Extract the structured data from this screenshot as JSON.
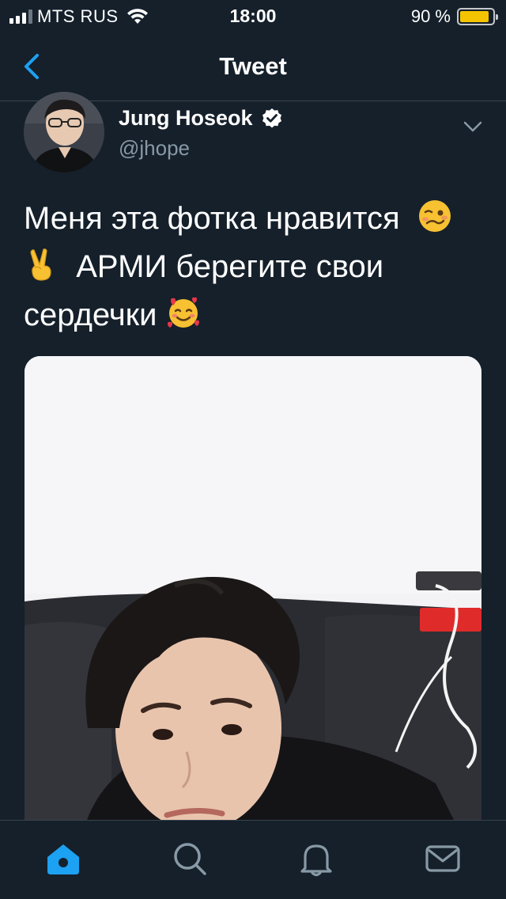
{
  "status_bar": {
    "carrier": "MTS RUS",
    "time": "18:00",
    "battery_percent": "90 %",
    "battery_level": 0.9,
    "signal_bars": 4,
    "signal_active": 3
  },
  "nav": {
    "title": "Tweet",
    "back_icon": "chevron-left-icon"
  },
  "tweet": {
    "user_name": "Jung Hoseok",
    "verified": true,
    "handle": "@jhope",
    "text_lines": [
      "Меня эта фотка нравится",
      " АРМИ берегите свои",
      "сердечки"
    ],
    "emojis": [
      "woozy-face-emoji",
      "victory-hand-emoji",
      "smiling-face-with-hearts-emoji"
    ],
    "more_icon": "chevron-down-icon"
  },
  "tab_bar": {
    "items": [
      {
        "icon": "home-icon",
        "active": true
      },
      {
        "icon": "search-icon",
        "active": false
      },
      {
        "icon": "bell-icon",
        "active": false
      },
      {
        "icon": "mail-icon",
        "active": false
      }
    ]
  },
  "colors": {
    "background": "#15202b",
    "accent": "#1da1f2",
    "secondary_text": "#8899a6",
    "divider": "#38444d",
    "battery": "#f5c400"
  }
}
